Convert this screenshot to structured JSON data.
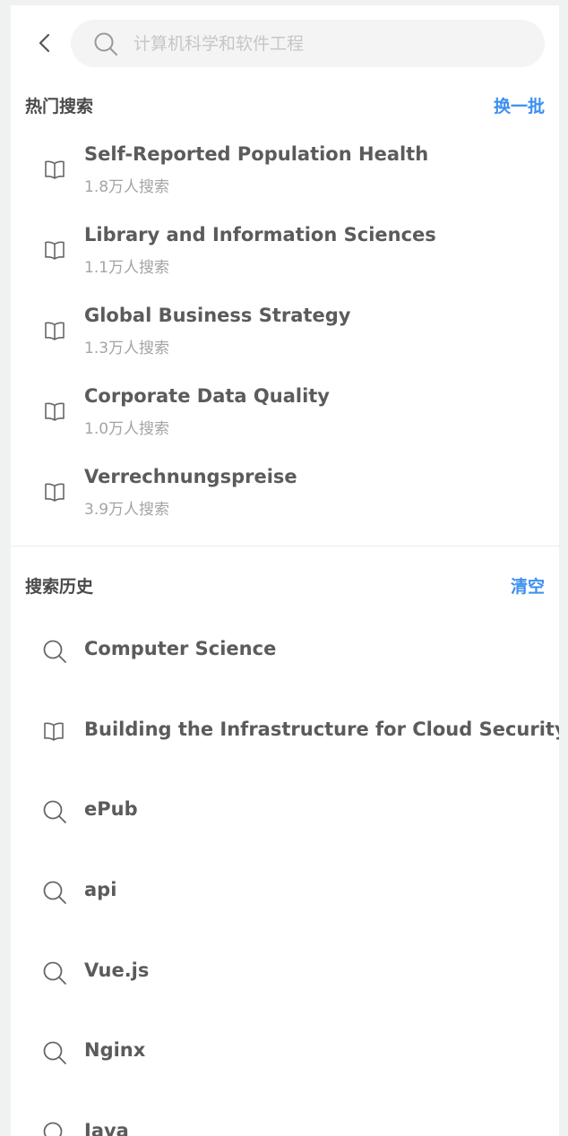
{
  "search": {
    "placeholder": "计算机科学和软件工程",
    "value": ""
  },
  "hot": {
    "title": "热门搜索",
    "action": "换一批",
    "items": [
      {
        "title": "Self-Reported Population Health",
        "count": "1.8万人搜索",
        "icon": "book-icon"
      },
      {
        "title": "Library and Information Sciences",
        "count": "1.1万人搜索",
        "icon": "book-icon"
      },
      {
        "title": "Global Business Strategy",
        "count": "1.3万人搜索",
        "icon": "book-icon"
      },
      {
        "title": "Corporate Data Quality",
        "count": "1.0万人搜索",
        "icon": "book-icon"
      },
      {
        "title": "Verrechnungspreise",
        "count": "3.9万人搜索",
        "icon": "book-icon"
      }
    ]
  },
  "history": {
    "title": "搜索历史",
    "action": "清空",
    "items": [
      {
        "label": "Computer Science",
        "icon": "search-icon"
      },
      {
        "label": "Building the Infrastructure for Cloud Security",
        "icon": "book-icon"
      },
      {
        "label": "ePub",
        "icon": "search-icon"
      },
      {
        "label": "api",
        "icon": "search-icon"
      },
      {
        "label": "Vue.js",
        "icon": "search-icon"
      },
      {
        "label": "Nginx",
        "icon": "search-icon"
      },
      {
        "label": "Java",
        "icon": "search-icon"
      }
    ]
  },
  "colors": {
    "accent": "#3d8ff0",
    "text": "#5b5b5b",
    "muted": "#a4a4a4",
    "searchBg": "#f4f4f4",
    "pageBg": "#f0f1f1"
  }
}
